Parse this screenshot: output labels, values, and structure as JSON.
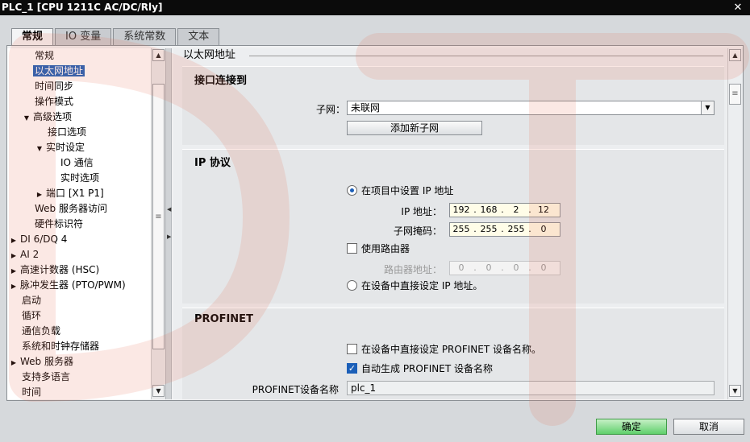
{
  "window": {
    "title": "PLC_1 [CPU 1211C AC/DC/Rly]",
    "close_glyph": "✕"
  },
  "tabs": [
    {
      "label": "常规",
      "active": true
    },
    {
      "label": "IO 变量",
      "active": false
    },
    {
      "label": "系统常数",
      "active": false
    },
    {
      "label": "文本",
      "active": false
    }
  ],
  "tree": {
    "items": [
      {
        "label": "常规",
        "level": 2,
        "expander": ""
      },
      {
        "label": "以太网地址",
        "level": 2,
        "expander": "",
        "selected": true
      },
      {
        "label": "时间同步",
        "level": 2,
        "expander": ""
      },
      {
        "label": "操作模式",
        "level": 2,
        "expander": ""
      },
      {
        "label": "高级选项",
        "level": 1,
        "expander": "▼"
      },
      {
        "label": "接口选项",
        "level": 3,
        "expander": ""
      },
      {
        "label": "实时设定",
        "level": 2,
        "expander": "▼",
        "indent_extra": true
      },
      {
        "label": "IO 通信",
        "level": 4,
        "expander": ""
      },
      {
        "label": "实时选项",
        "level": 4,
        "expander": ""
      },
      {
        "label": "端口 [X1 P1]",
        "level": 2,
        "expander": "▶",
        "indent_extra": true
      },
      {
        "label": "Web 服务器访问",
        "level": 2,
        "expander": ""
      },
      {
        "label": "硬件标识符",
        "level": 2,
        "expander": ""
      },
      {
        "label": "DI 6/DQ 4",
        "level": 0,
        "expander": "▶"
      },
      {
        "label": "AI 2",
        "level": 0,
        "expander": "▶"
      },
      {
        "label": "高速计数器 (HSC)",
        "level": 0,
        "expander": "▶"
      },
      {
        "label": "脉冲发生器 (PTO/PWM)",
        "level": 0,
        "expander": "▶"
      },
      {
        "label": "启动",
        "level": 0,
        "expander": ""
      },
      {
        "label": "循环",
        "level": 0,
        "expander": ""
      },
      {
        "label": "通信负载",
        "level": 0,
        "expander": ""
      },
      {
        "label": "系统和时钟存储器",
        "level": 0,
        "expander": ""
      },
      {
        "label": "Web 服务器",
        "level": 0,
        "expander": "▶"
      },
      {
        "label": "支持多语言",
        "level": 0,
        "expander": ""
      },
      {
        "label": "时间",
        "level": 0,
        "expander": ""
      }
    ]
  },
  "content": {
    "header": "以太网地址",
    "interface": {
      "title": "接口连接到",
      "subnet_label": "子网：",
      "subnet_value": "未联网",
      "add_subnet_button": "添加新子网"
    },
    "ip": {
      "title": "IP 协议",
      "opt_project": "在项目中设置 IP 地址",
      "ip_label": "IP 地址：",
      "ip_value": [
        "192",
        "168",
        "2",
        "12"
      ],
      "mask_label": "子网掩码：",
      "mask_value": [
        "255",
        "255",
        "255",
        "0"
      ],
      "use_router": "使用路由器",
      "router_label": "路由器地址：",
      "router_value": [
        "0",
        "0",
        "0",
        "0"
      ],
      "opt_device": "在设备中直接设定 IP 地址。",
      "ip_dot": "."
    },
    "profinet": {
      "title": "PROFINET",
      "opt_direct_name": "在设备中直接设定 PROFINET 设备名称。",
      "opt_auto_name": "自动生成 PROFINET 设备名称",
      "name_label": "PROFINET设备名称",
      "name_value": "plc_1"
    }
  },
  "footer": {
    "ok": "确定",
    "cancel": "取消"
  },
  "colors": {
    "selection": "#1b5fb8",
    "ok_button": "#5fcf6b",
    "watermark": "#e8735a"
  }
}
